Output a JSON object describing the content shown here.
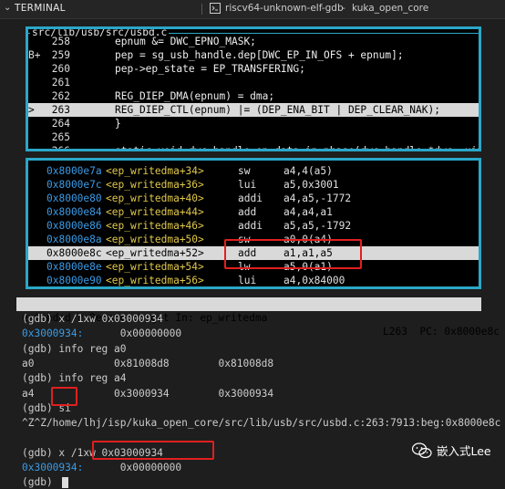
{
  "panel": {
    "title": "TERMINAL",
    "tab1": "riscv64-unknown-elf-gdb",
    "tab2": "kuka_open_core"
  },
  "source": {
    "filename": "src/lib/usb/src/usbd.c",
    "lines": [
      {
        "mark": "",
        "num": "258",
        "code": "epnum &= DWC_EPNO_MASK;"
      },
      {
        "mark": "B+",
        "num": "259",
        "code": "pep = sg_usb_handle.dep[DWC_EP_IN_OFS + epnum];"
      },
      {
        "mark": "",
        "num": "260",
        "code": "pep->ep_state = EP_TRANSFERING;"
      },
      {
        "mark": "",
        "num": "261",
        "code": ""
      },
      {
        "mark": "",
        "num": "262",
        "code": "REG_DIEP_DMA(epnum) = dma;"
      },
      {
        "mark": ">",
        "num": "263",
        "code": "REG_DIEP_CTL(epnum) |= (DEP_ENA_BIT | DEP_CLEAR_NAK);"
      },
      {
        "mark": "",
        "num": "264",
        "code": "}"
      },
      {
        "mark": "",
        "num": "265",
        "code": ""
      },
      {
        "mark": "",
        "num": "266",
        "code": "static void dwc_handle_ep_data_in_phase(dwc_handle *dwc, uint"
      }
    ]
  },
  "disasm": [
    {
      "mark": "",
      "addr": "0x8000e7a",
      "sym": "<ep_writedma+34>",
      "mn": "sw",
      "op": "a4,4(a5)"
    },
    {
      "mark": "",
      "addr": "0x8000e7c",
      "sym": "<ep_writedma+36>",
      "mn": "lui",
      "op": "a5,0x3001"
    },
    {
      "mark": "",
      "addr": "0x8000e80",
      "sym": "<ep_writedma+40>",
      "mn": "addi",
      "op": "a4,a5,-1772"
    },
    {
      "mark": "",
      "addr": "0x8000e84",
      "sym": "<ep_writedma+44>",
      "mn": "add",
      "op": "a4,a4,a1"
    },
    {
      "mark": "",
      "addr": "0x8000e86",
      "sym": "<ep_writedma+46>",
      "mn": "addi",
      "op": "a5,a5,-1792"
    },
    {
      "mark": "",
      "addr": "0x8000e8a",
      "sym": "<ep_writedma+50>",
      "mn": "sw",
      "op": "a0,0(a4)"
    },
    {
      "mark": ">",
      "addr": "0x8000e8c",
      "sym": "<ep_writedma+52>",
      "mn": "add",
      "op": "a1,a1,a5"
    },
    {
      "mark": "",
      "addr": "0x8000e8e",
      "sym": "<ep_writedma+54>",
      "mn": "lw",
      "op": "a5,0(a1)"
    },
    {
      "mark": "",
      "addr": "0x8000e90",
      "sym": "<ep_writedma+56>",
      "mn": "lui",
      "op": "a4,0x84000"
    }
  ],
  "status": {
    "left": "extended-r Remote target In: ep_writedma",
    "right": "L263  PC: 0x8000e8c"
  },
  "terminal": [
    {
      "a": "(gdb) x /1xw 0x03000934",
      "b": ""
    },
    {
      "a": "0x3000934:",
      "b": "      0x00000000",
      "blue": true
    },
    {
      "a": "(gdb) info reg a0",
      "b": ""
    },
    {
      "a": "a0             0x81008d8        0x81008d8",
      "b": ""
    },
    {
      "a": "(gdb) info reg a4",
      "b": ""
    },
    {
      "a": "a4             0x3000934        0x3000934",
      "b": ""
    },
    {
      "a": "(gdb) si",
      "b": ""
    },
    {
      "a": "^Z^Z/home/lhj/isp/kuka_open_core/src/lib/usb/src/usbd.c:263:7913:beg:0x8000e8c",
      "b": ""
    },
    {
      "a": "",
      "b": ""
    },
    {
      "a": "(gdb) x /1xw 0x03000934",
      "b": ""
    },
    {
      "a": "0x3000934:",
      "b": "      0x00000000",
      "blue": true
    },
    {
      "a": "(gdb) ",
      "b": "",
      "cursor": true
    }
  ],
  "watermark": "嵌入式Lee",
  "colors": {
    "border": "#2aa7c8",
    "address": "#3a9be6",
    "symbol": "#e0c84a",
    "highlight": "#d9d9d9",
    "annotation": "#e0201f"
  }
}
